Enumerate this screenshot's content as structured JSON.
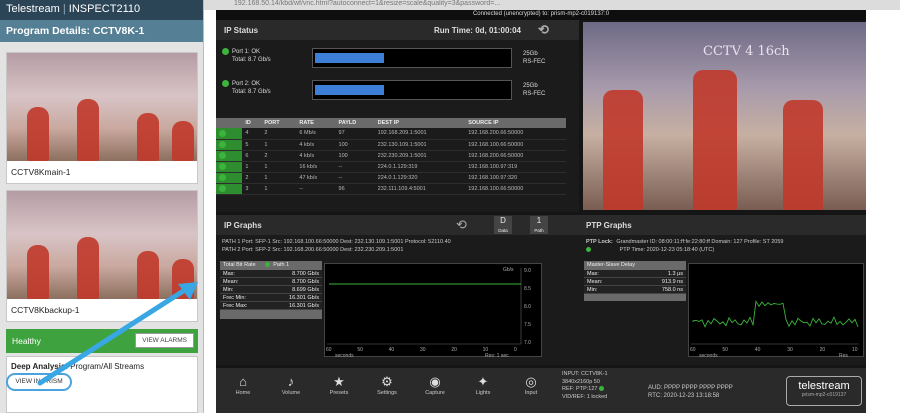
{
  "left_panel": {
    "brand": "Telestream",
    "product": "INSPECT2110",
    "program_title": "Program Details: CCTV8K-1",
    "streams": [
      {
        "caption": "CCTV8Kmain-1"
      },
      {
        "caption": "CCTV8Kbackup-1"
      }
    ],
    "status": "Healthy",
    "view_alarms_label": "VIEW ALARMS",
    "deep_analysis_label": "Deep Analysis:",
    "deep_analysis_value": "Program/All Streams",
    "view_in_prism_label": "VIEW IN PRISM"
  },
  "browser": {
    "url": "192.168.50.14/kbd/wf/vnc.html?autoconnect=1&resize=scale&quality=3&password=...",
    "connection_status": "Connected (unencrypted) to: prism-mp2-c019137:0"
  },
  "prism": {
    "ip_status": {
      "title": "IP Status",
      "run_time": "Run Time: 0d, 01:00:04",
      "ports": [
        {
          "line1": "Port 1: OK",
          "line2": "Total:  8.7 Gb/s",
          "rate": "25Gb",
          "fec": "RS-FEC",
          "bar_fill": 0.35
        },
        {
          "line1": "Port 2: OK",
          "line2": "Total:  8.7 Gb/s",
          "rate": "25Gb",
          "fec": "RS-FEC",
          "bar_fill": 0.35
        }
      ],
      "table_headers": [
        "",
        "ID",
        "PORT",
        "RATE",
        "PAYLD",
        "DEST IP",
        "SOURCE IP"
      ],
      "table_rows": [
        [
          "",
          "4",
          "2",
          "6 Mb/s",
          "97",
          "192.168.209.1:5001",
          "192.168.200.66:50000"
        ],
        [
          "",
          "5",
          "1",
          "4 kb/s",
          "100",
          "232.130.109.1:5001",
          "192.168.100.66:50000"
        ],
        [
          "",
          "6",
          "2",
          "4 kb/s",
          "100",
          "232.230.209.1:5001",
          "192.168.200.66:50000"
        ],
        [
          "",
          "1",
          "1",
          "16 kb/s",
          "--",
          "224.0.1.129:319",
          "192.168.100.97:319"
        ],
        [
          "",
          "2",
          "1",
          "47 kb/s",
          "--",
          "224.0.1.129:320",
          "192.168.100.97:320"
        ],
        [
          "",
          "3",
          "1",
          "--",
          "96",
          "232.111.109.4:5001",
          "192.168.100.66:50000"
        ]
      ]
    },
    "ip_graphs": {
      "title": "IP Graphs",
      "data_btn": "Data",
      "path_btn": "Path",
      "path_btn_num": "1",
      "data_btn_letter": "D",
      "path1": "PATH 1  Port: SFP-1  Src: 192.168.100.66:50000  Dest: 232.130.109.1:5001  Protocol: 52110.40",
      "path2": "PATH 2  Port: SFP-2  Src: 192.168.200.66:50000  Dest: 232.230.209.1:5001",
      "box_title": "Total Bit Rate",
      "box_legend": "Path 1",
      "stats": [
        {
          "label": "Max:",
          "value": "8.700 Gb/s"
        },
        {
          "label": "Mean:",
          "value": "8.700 Gb/s"
        },
        {
          "label": "Min:",
          "value": "8.699 Gb/s"
        },
        {
          "label": "Frec Min:",
          "value": "16.301 Gb/s"
        },
        {
          "label": "Frec Max:",
          "value": "16.301 Gb/s"
        }
      ],
      "y_unit": "Gb/s",
      "y_ticks": [
        "9.0",
        "8.5",
        "8.0",
        "7.5",
        "7.0"
      ],
      "x_ticks": [
        "60",
        "50",
        "40",
        "30",
        "20",
        "10",
        "0"
      ],
      "x_label": "seconds",
      "x_note": "Res: 1 sec"
    },
    "ptp_graphs": {
      "title": "PTP Graphs",
      "ptp_lock": "PTP Lock:",
      "grandmaster": "Grandmaster ID: 08:00:11:ff:fe:22:80:ff  Domain: 127  Profile: ST 2059",
      "ptp_time": "PTP Time: 2020-12-23 05:18:40 (UTC)",
      "box_title": "Master-Slave Delay",
      "stats": [
        {
          "label": "Max:",
          "value": "1.3 μs"
        },
        {
          "label": "Mean:",
          "value": "913.9 ns"
        },
        {
          "label": "Min:",
          "value": "758.0 ns"
        }
      ],
      "x_ticks": [
        "60",
        "50",
        "40",
        "30",
        "20",
        "10"
      ],
      "x_label": "seconds",
      "x_note": "Res"
    },
    "nav": [
      {
        "icon": "home",
        "label": "Home"
      },
      {
        "icon": "volume",
        "label": "Volume"
      },
      {
        "icon": "presets",
        "label": "Presets"
      },
      {
        "icon": "settings",
        "label": "Settings"
      },
      {
        "icon": "capture",
        "label": "Capture"
      },
      {
        "icon": "lights",
        "label": "Lights"
      },
      {
        "icon": "input",
        "label": "Input"
      }
    ],
    "input_info": {
      "line1": "INPUT: CCTV8K-1",
      "line2": "3840x2160p 50",
      "line3": "REF: PTP:127",
      "line4": "VID/REF: 1 locked"
    },
    "aud_line": "AUD: PPPP PPPP PPPP PPPP",
    "rtc_line": "RTC: 2020-12-23 13:18:58",
    "logo": "telestream",
    "logo_sub": "prism-mp2-c019137"
  },
  "colors": {
    "accent_blue": "#3d7ed6",
    "ok_green": "#3ab43a",
    "header_dark": "#2b4456",
    "title_bar": "#557f95",
    "arrow": "#39a7e3"
  }
}
